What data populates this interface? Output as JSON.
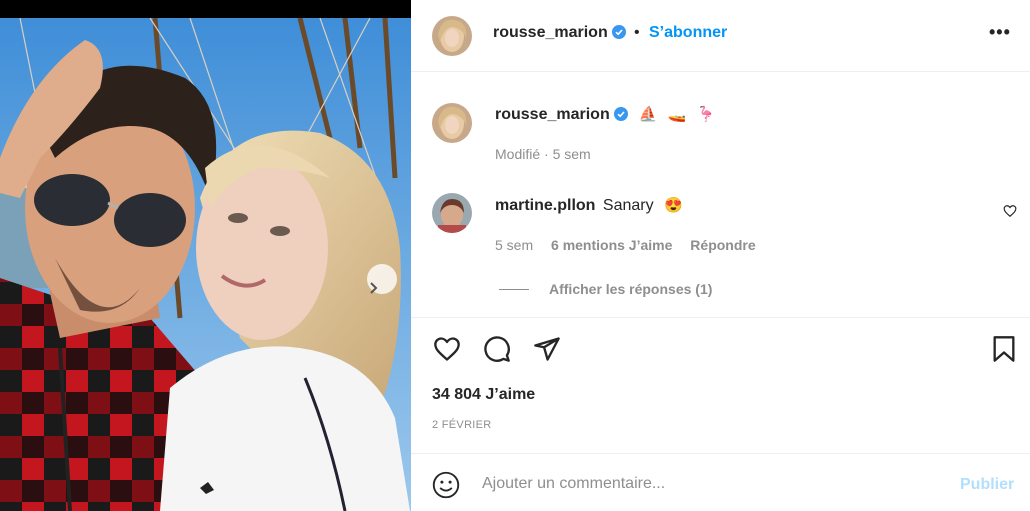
{
  "post_author": {
    "username": "rousse_marion",
    "follow_label": "S’abonner",
    "separator": "•",
    "more_label": "•••"
  },
  "caption": {
    "username": "rousse_marion",
    "emojis": [
      "⛵",
      "🚤",
      "🦩"
    ],
    "modified_label": "Modifié · 5 sem"
  },
  "comment": {
    "username": "martine.pllon",
    "text": "Sanary",
    "emoji": "😍",
    "time": "5 sem",
    "likes": "6 mentions J’aime",
    "reply_label": "Répondre",
    "view_replies": "Afficher les réponses (1)"
  },
  "actions": {
    "like_icon": "heart-icon",
    "comment_icon": "comment-icon",
    "share_icon": "send-icon",
    "save_icon": "bookmark-icon"
  },
  "likes_count": "34 804 J’aime",
  "post_date": "2 FÉVRIER",
  "add_comment": {
    "placeholder": "Ajouter un commentaire...",
    "publish_label": "Publier"
  },
  "colors": {
    "accent": "#0095f6",
    "publish_disabled": "#b2dffc",
    "secondary_text": "#8e8e8e",
    "verified": "#3897f0"
  }
}
